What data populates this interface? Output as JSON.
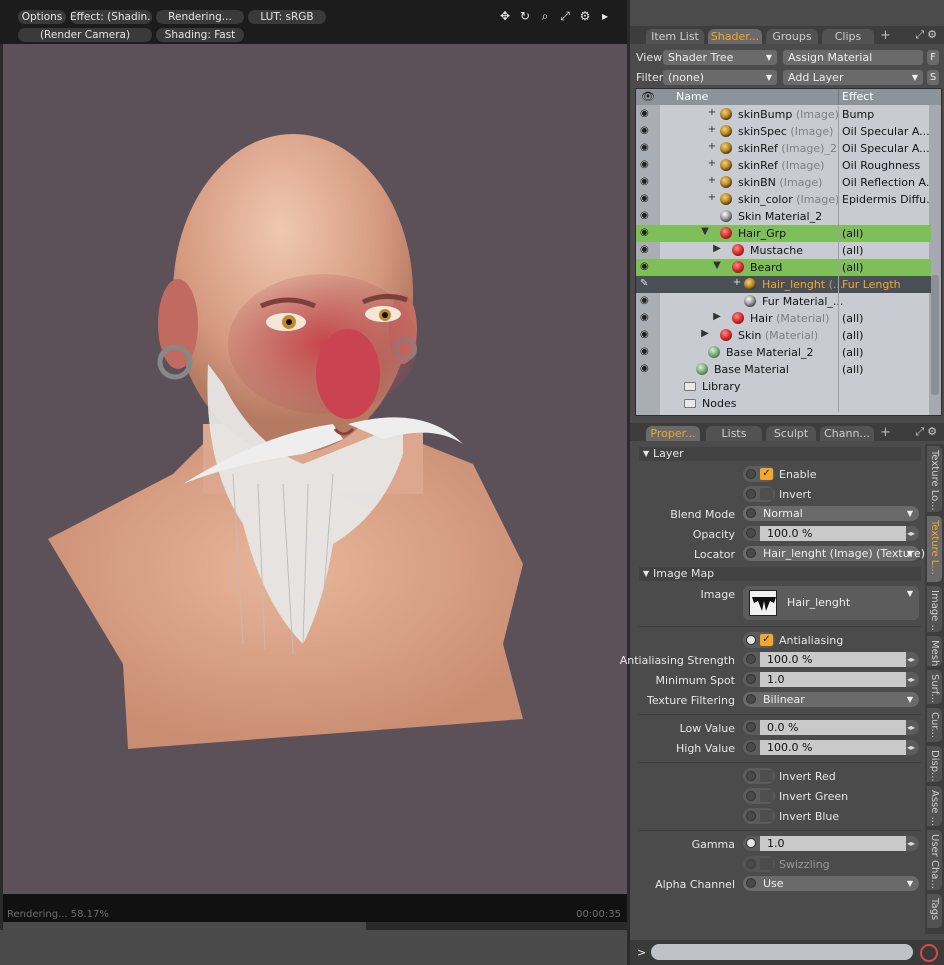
{
  "viewport": {
    "toolbar": {
      "options": "Options",
      "effect": "Effect: (Shadin...",
      "rendering": "Rendering...",
      "lut": "LUT: sRGB",
      "camera": "(Render Camera)",
      "shading": "Shading: Fast"
    },
    "icons": [
      "move-icon",
      "rotate-icon",
      "zoom-icon",
      "maximize-icon",
      "gear-icon",
      "play-icon"
    ],
    "status": "Rendering... 58.17%",
    "progress": 58.17,
    "time": "00:00:35",
    "background_color": "#5c5059"
  },
  "top_tabs": {
    "items": [
      "Item List",
      "Shader...",
      "Groups",
      "Clips"
    ],
    "active": 1
  },
  "shader_panel": {
    "view_label": "View",
    "view_value": "Shader Tree",
    "assign_material": "Assign Material",
    "f_button": "F",
    "filter_label": "Filter",
    "filter_value": "(none)",
    "add_layer": "Add Layer",
    "s_button": "S",
    "col_name": "Name",
    "col_effect": "Effect",
    "rows": [
      {
        "name": "skinBump",
        "sub": " (Image)",
        "effect": "Bump"
      },
      {
        "name": "skinSpec",
        "sub": " (Image)",
        "effect": "Oil Specular A..."
      },
      {
        "name": "skinRef",
        "sub": " (Image)_2",
        "effect": "Oil Specular A..."
      },
      {
        "name": "skinRef",
        "sub": " (Image)",
        "effect": "Oil Roughness"
      },
      {
        "name": "skinBN",
        "sub": " (Image)",
        "effect": "Oil Reflection A..."
      },
      {
        "name": "skin_color",
        "sub": " (Image)",
        "effect": "Epidermis Diffu..."
      },
      {
        "name": "Skin Material_2",
        "sub": "",
        "effect": ""
      },
      {
        "name": "Hair_Grp",
        "sub": "",
        "effect": "(all)"
      },
      {
        "name": "Mustache",
        "sub": "",
        "effect": "(all)"
      },
      {
        "name": "Beard",
        "sub": "",
        "effect": "(all)"
      },
      {
        "name": "Hair_lenght",
        "sub": " (...",
        "effect": "Fur Length"
      },
      {
        "name": "Fur Material_...",
        "sub": "",
        "effect": ""
      },
      {
        "name": "Hair",
        "sub": " (Material)",
        "effect": "(all)"
      },
      {
        "name": "Skin",
        "sub": " (Material)",
        "effect": "(all)"
      },
      {
        "name": "Base Material_2",
        "sub": "",
        "effect": "(all)"
      },
      {
        "name": "Base Material",
        "sub": "",
        "effect": "(all)"
      },
      {
        "name": "Library",
        "sub": "",
        "effect": ""
      },
      {
        "name": "Nodes",
        "sub": "",
        "effect": ""
      }
    ]
  },
  "bottom_tabs": {
    "items": [
      "Proper...",
      "Lists",
      "Sculpt",
      "Chann..."
    ],
    "active": 0
  },
  "properties": {
    "layer_section": "Layer",
    "enable": "Enable",
    "invert": "Invert",
    "blend_mode_label": "Blend Mode",
    "blend_mode": "Normal",
    "opacity_label": "Opacity",
    "opacity": "100.0 %",
    "locator_label": "Locator",
    "locator": "Hair_lenght (Image) (Texture)",
    "image_map_section": "Image Map",
    "image_label": "Image",
    "image_name": "Hair_lenght",
    "antialiasing": "Antialiasing",
    "aa_strength_label": "Antialiasing Strength",
    "aa_strength": "100.0 %",
    "min_spot_label": "Minimum Spot",
    "min_spot": "1.0",
    "tex_filter_label": "Texture Filtering",
    "tex_filter": "Bilinear",
    "low_value_label": "Low Value",
    "low_value": "0.0 %",
    "high_value_label": "High Value",
    "high_value": "100.0 %",
    "invert_red": "Invert Red",
    "invert_green": "Invert Green",
    "invert_blue": "Invert Blue",
    "gamma_label": "Gamma",
    "gamma": "1.0",
    "swizzling": "Swizzling",
    "alpha_channel_label": "Alpha Channel",
    "alpha_channel": "Use"
  },
  "side_tabs": [
    "Texture Lo...",
    "Texture L...",
    "Image ...",
    "Mesh",
    "Surf...",
    "Cur...",
    "Disp...",
    "Asse ...",
    "User Cha...",
    "Tags"
  ],
  "side_tab_active": 1,
  "command": {
    "prompt": ">"
  },
  "colors": {
    "accent": "#f3a72c",
    "selection_green": "#7fbf5a",
    "stop": "#d94a4a"
  }
}
